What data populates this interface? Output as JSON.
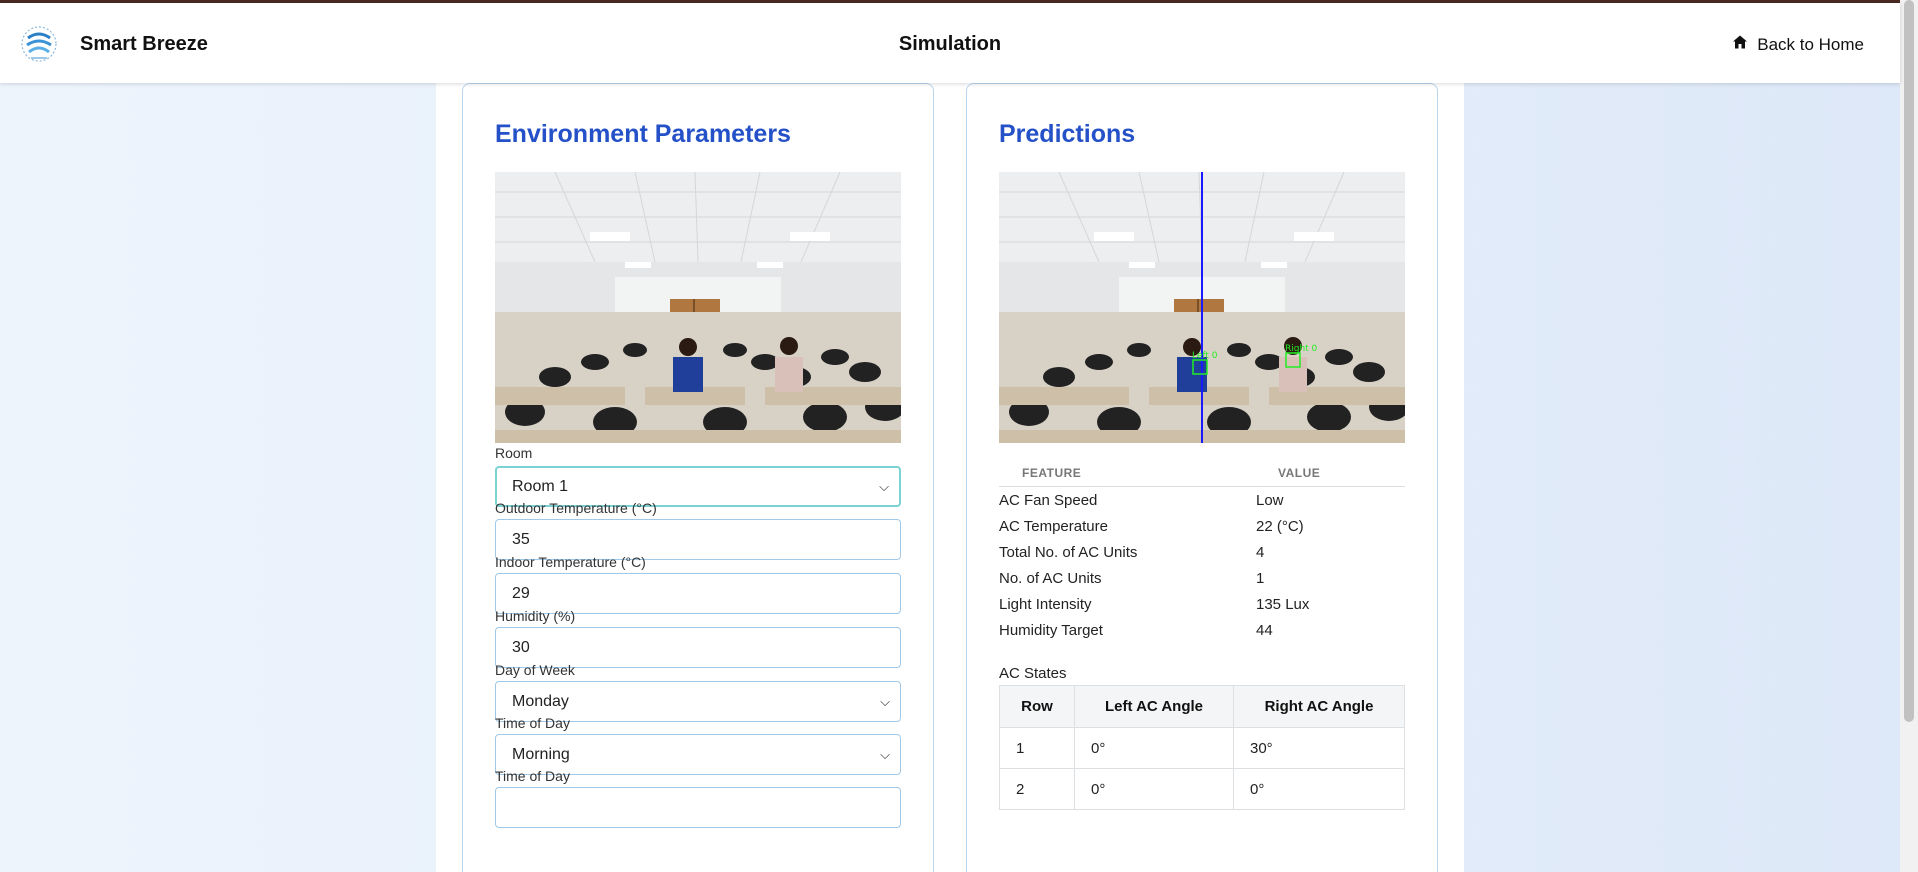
{
  "header": {
    "brand": "Smart Breeze",
    "page_title": "Simulation",
    "back_label": "Back to Home",
    "back_icon": "home-icon"
  },
  "environment": {
    "title": "Environment Parameters",
    "fields": [
      {
        "label": "Room",
        "value": "Room 1",
        "type": "select"
      },
      {
        "label": "Outdoor Temperature (°C)",
        "value": "35",
        "type": "input"
      },
      {
        "label": "Indoor Temperature (°C)",
        "value": "29",
        "type": "input"
      },
      {
        "label": "Humidity (%)",
        "value": "30",
        "type": "input"
      },
      {
        "label": "Day of Week",
        "value": "Monday",
        "type": "select"
      },
      {
        "label": "Time of Day",
        "value": "Morning",
        "type": "select"
      },
      {
        "label": "Time of Day",
        "value": "",
        "type": "select"
      }
    ]
  },
  "predictions": {
    "title": "Predictions",
    "detections": [
      "Left 0",
      "Right 0"
    ],
    "table_headers": [
      "FEATURE",
      "VALUE"
    ],
    "rows": [
      {
        "feature": "AC Fan Speed",
        "value": "Low"
      },
      {
        "feature": "AC Temperature",
        "value": "22 (°C)"
      },
      {
        "feature": "Total No. of AC Units",
        "value": "4"
      },
      {
        "feature": "No. of AC Units",
        "value": "1"
      },
      {
        "feature": "Light Intensity",
        "value": "135 Lux"
      },
      {
        "feature": "Humidity Target",
        "value": "44"
      }
    ],
    "ac_states_label": "AC States",
    "ac_headers": [
      "Row",
      "Left AC Angle",
      "Right AC Angle"
    ],
    "ac_rows": [
      {
        "row": "1",
        "left": "0°",
        "right": "30°"
      },
      {
        "row": "2",
        "left": "0°",
        "right": "0°"
      }
    ]
  },
  "colors": {
    "accent": "#2450c8",
    "field_border": "#9fc9ea",
    "detection_box": "#22ee22",
    "divider_line": "#1a1aff"
  }
}
